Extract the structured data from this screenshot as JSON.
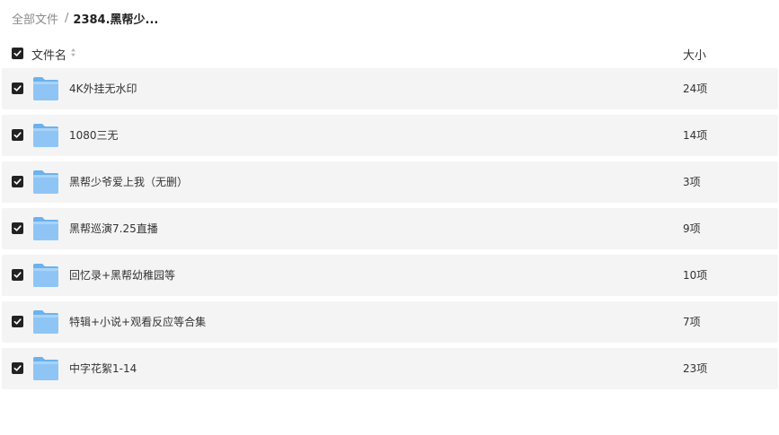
{
  "breadcrumb": {
    "root": "全部文件",
    "separator": "/",
    "current": "2384.黑帮少..."
  },
  "header": {
    "name_label": "文件名",
    "size_label": "大小",
    "select_all_checked": true
  },
  "rows": [
    {
      "name": "4K外挂无水印",
      "size": "24项",
      "checked": true
    },
    {
      "name": "1080三无",
      "size": "14项",
      "checked": true
    },
    {
      "name": "黑帮少爷爱上我（无删）",
      "size": "3项",
      "checked": true
    },
    {
      "name": "黑帮巡演7.25直播",
      "size": "9项",
      "checked": true
    },
    {
      "name": "回忆录+黑帮幼稚园等",
      "size": "10项",
      "checked": true
    },
    {
      "name": "特辑+小说+观看反应等合集",
      "size": "7项",
      "checked": true
    },
    {
      "name": "中字花絮1-14",
      "size": "23项",
      "checked": true
    }
  ],
  "icons": {
    "row_icon": "folder-icon",
    "checkbox_icon": "checkmark-icon",
    "sort_icon": "sort-icon"
  },
  "colors": {
    "row_background": "#f4f4f5",
    "checkbox": "#222222",
    "folder": "#8ec5f5"
  }
}
